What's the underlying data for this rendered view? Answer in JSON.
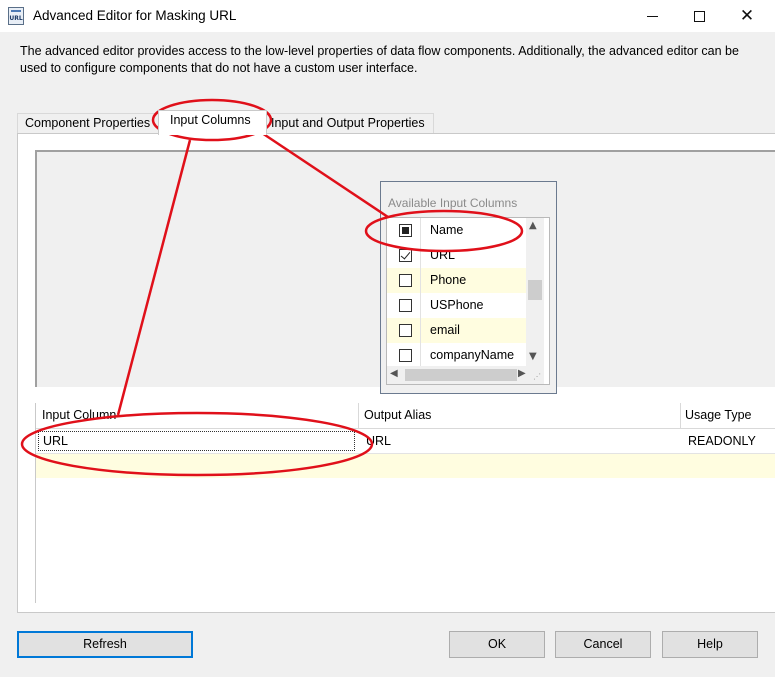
{
  "window": {
    "title": "Advanced Editor for Masking URL",
    "icon": "url-component-icon",
    "icon_text": "URL",
    "close_glyph": "✕"
  },
  "description": "The advanced editor provides access to the low-level properties of data flow components. Additionally, the advanced editor can be used to configure components that do not have a custom user interface.",
  "tabs": [
    {
      "label": "Component Properties",
      "active": false
    },
    {
      "label": "Input Columns",
      "active": true
    },
    {
      "label": "Input and Output Properties",
      "active": false
    }
  ],
  "available_columns": {
    "title": "Available Input Columns",
    "header": "Name",
    "header_state": "partial",
    "items": [
      {
        "label": "URL",
        "checked": true
      },
      {
        "label": "Phone",
        "checked": false
      },
      {
        "label": "USPhone",
        "checked": false
      },
      {
        "label": "email",
        "checked": false
      },
      {
        "label": "companyName",
        "checked": false
      }
    ],
    "scroll_up": "▲",
    "scroll_down": "▼",
    "scroll_left": "◀",
    "scroll_right": "▶",
    "grip": "⋰"
  },
  "mapping_grid": {
    "headers": [
      "Input Column",
      "Output Alias",
      "Usage Type"
    ],
    "rows": [
      {
        "input": "URL",
        "alias": "URL",
        "usage": "READONLY"
      }
    ]
  },
  "buttons": {
    "refresh": "Refresh",
    "ok": "OK",
    "cancel": "Cancel",
    "help": "Help"
  },
  "colors": {
    "annotation": "#e0101a",
    "focus_border": "#0078d7",
    "alt_row": "#fffde0"
  }
}
